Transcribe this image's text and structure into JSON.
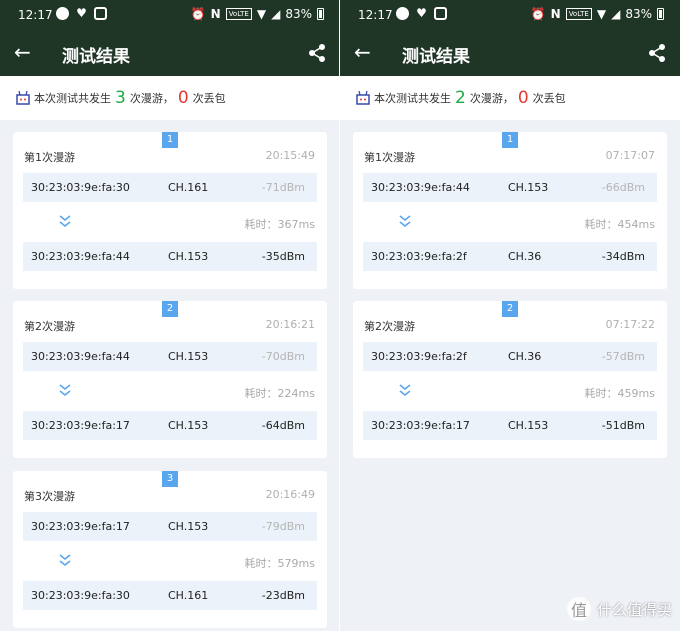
{
  "colors": {
    "header_bg": "#1f3526",
    "accent_green": "#1faa46",
    "accent_red": "#e53935",
    "badge_blue": "#5aa6ee",
    "row_bg": "#ebf2f9",
    "page_bg": "#eef1f6"
  },
  "icons": {
    "back": "arrow-left-icon",
    "share": "share-icon",
    "summary": "router-icon",
    "roam_arrow": "double-chevron-down-icon"
  },
  "phones": [
    {
      "status": {
        "time": "12:17",
        "battery": "83%",
        "volte": "VoLTE"
      },
      "appbar": {
        "back": "←",
        "title": "测试结果"
      },
      "summary": {
        "prefix": "本次测试共发生",
        "roam_count": "3",
        "mid": "次漫游，",
        "loss_count": "0",
        "suffix": "次丢包"
      },
      "cards": [
        {
          "badge": "1",
          "title": "第1次漫游",
          "time": "20:15:49",
          "from": {
            "mac": "30:23:03:9e:fa:30",
            "channel": "CH.161",
            "rssi": "-71dBm"
          },
          "elapsed": "耗时：367ms",
          "to": {
            "mac": "30:23:03:9e:fa:44",
            "channel": "CH.153",
            "rssi": "-35dBm"
          }
        },
        {
          "badge": "2",
          "title": "第2次漫游",
          "time": "20:16:21",
          "from": {
            "mac": "30:23:03:9e:fa:44",
            "channel": "CH.153",
            "rssi": "-70dBm"
          },
          "elapsed": "耗时：224ms",
          "to": {
            "mac": "30:23:03:9e:fa:17",
            "channel": "CH.153",
            "rssi": "-64dBm"
          }
        },
        {
          "badge": "3",
          "title": "第3次漫游",
          "time": "20:16:49",
          "from": {
            "mac": "30:23:03:9e:fa:17",
            "channel": "CH.153",
            "rssi": "-79dBm"
          },
          "elapsed": "耗时：579ms",
          "to": {
            "mac": "30:23:03:9e:fa:30",
            "channel": "CH.161",
            "rssi": "-23dBm"
          }
        }
      ]
    },
    {
      "status": {
        "time": "12:17",
        "battery": "83%",
        "volte": "VoLTE"
      },
      "appbar": {
        "back": "←",
        "title": "测试结果"
      },
      "summary": {
        "prefix": "本次测试共发生",
        "roam_count": "2",
        "mid": "次漫游，",
        "loss_count": "0",
        "suffix": "次丢包"
      },
      "cards": [
        {
          "badge": "1",
          "title": "第1次漫游",
          "time": "07:17:07",
          "from": {
            "mac": "30:23:03:9e:fa:44",
            "channel": "CH.153",
            "rssi": "-66dBm"
          },
          "elapsed": "耗时：454ms",
          "to": {
            "mac": "30:23:03:9e:fa:2f",
            "channel": "CH.36",
            "rssi": "-34dBm"
          }
        },
        {
          "badge": "2",
          "title": "第2次漫游",
          "time": "07:17:22",
          "from": {
            "mac": "30:23:03:9e:fa:2f",
            "channel": "CH.36",
            "rssi": "-57dBm"
          },
          "elapsed": "耗时：459ms",
          "to": {
            "mac": "30:23:03:9e:fa:17",
            "channel": "CH.153",
            "rssi": "-51dBm"
          }
        }
      ]
    }
  ],
  "watermark": {
    "text": "什么值得买",
    "logo": "值"
  }
}
